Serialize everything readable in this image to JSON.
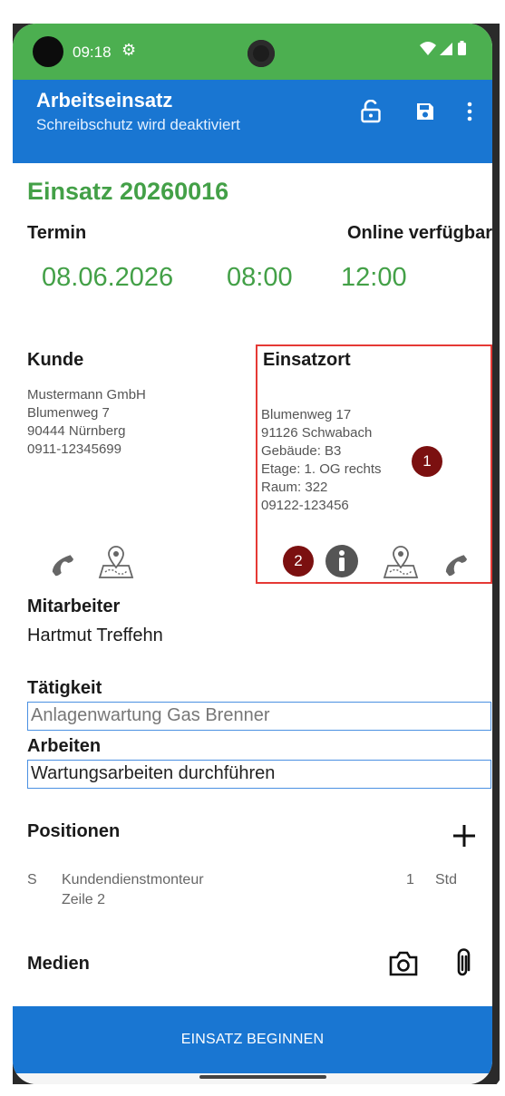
{
  "status": {
    "time": "09:18"
  },
  "appbar": {
    "title": "Arbeitseinsatz",
    "subtitle": "Schreibschutz wird deaktiviert",
    "icons": [
      "lock-open-icon",
      "save-icon",
      "more-vert-icon"
    ]
  },
  "einsatz": {
    "title": "Einsatz 20260016"
  },
  "termin": {
    "label": "Termin",
    "online_label": "Online verfügbar",
    "date": "08.06.2026",
    "start": "08:00",
    "end": "12:00"
  },
  "kunde": {
    "label": "Kunde",
    "address": "Mustermann GmbH\nBlumenweg 7\n90444 Nürnberg\n0911-12345699"
  },
  "einsatzort": {
    "label": "Einsatzort",
    "address": "Blumenweg 17\n91126 Schwabach\nGebäude: B3\nEtage: 1. OG rechts\nRaum: 322\n09122-123456",
    "badge1": "1",
    "badge2": "2"
  },
  "mitarbeiter": {
    "label": "Mitarbeiter",
    "name": "Hartmut Treffehn"
  },
  "taetigkeit": {
    "label": "Tätigkeit",
    "value": "Anlagenwartung Gas Brenner"
  },
  "arbeiten": {
    "label": "Arbeiten",
    "value": "Wartungsarbeiten durchführen"
  },
  "positionen": {
    "label": "Positionen",
    "items": [
      {
        "type": "S",
        "name": "Kundendienstmonteur",
        "line2": "Zeile 2",
        "qty": "1",
        "unit": "Std"
      }
    ]
  },
  "medien": {
    "label": "Medien"
  },
  "action": {
    "label": "EINSATZ BEGINNEN"
  },
  "colors": {
    "accent": "#1976d2",
    "green": "#43a047",
    "status": "#4caf50",
    "highlight": "#e53935",
    "badge": "#7b1010"
  }
}
